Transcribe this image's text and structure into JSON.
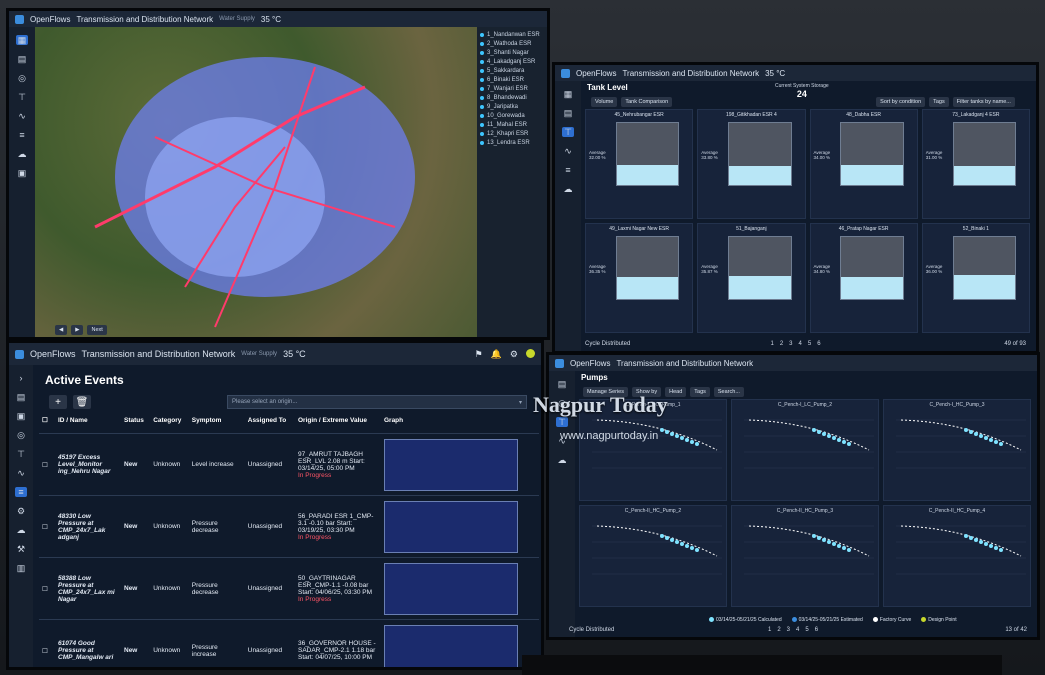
{
  "brand": {
    "app_name": "OpenFlows",
    "accent": "#2e6fd1"
  },
  "panels": {
    "map": {
      "title": "Transmission and Distribution Network",
      "subtitle": "Water Supply",
      "temp": "35 °C",
      "layers": [
        "1_Nandanwan ESR",
        "2_Wathoda ESR",
        "3_Shanti Nagar",
        "4_Lakadganj ESR",
        "5_Sakkardara",
        "6_Binaki ESR",
        "7_Wanjari ESR",
        "8_Bhandewadi",
        "9_Jaripatka",
        "10_Gorewada",
        "11_Mahal ESR",
        "12_Khapri ESR",
        "13_Lendra ESR"
      ],
      "footer_btn": "Next"
    },
    "tanks": {
      "title": "Tank Level",
      "app": "OpenFlows",
      "header": "Transmission and Distribution Network",
      "temp": "35 °C",
      "current_storage_label": "Current System Storage",
      "current_storage_value": "24",
      "toolbar": [
        "Volume",
        "Tank Comparison",
        "Sort by condition",
        "Tags",
        "Filter tanks by name..."
      ],
      "cards": [
        {
          "name": "45_Nehrubangar ESR",
          "fill": 0.32,
          "avg": "Average 32.00 %"
        },
        {
          "name": "198_Gitikhadan ESR 4",
          "fill": 0.3,
          "avg": "Average 33.80 %"
        },
        {
          "name": "48_Dabha ESR",
          "fill": 0.33,
          "avg": "Average 34.00 %"
        },
        {
          "name": "73_Lakadganj 4 ESR",
          "fill": 0.31,
          "avg": "Average 31.00 %"
        },
        {
          "name": "49_Laxmi Nagar New ESR",
          "fill": 0.36,
          "avg": "Average 36.35 %"
        },
        {
          "name": "51_Bajanganj",
          "fill": 0.37,
          "avg": "Average 35.87 %"
        },
        {
          "name": "46_Pratap Nagar ESR",
          "fill": 0.35,
          "avg": "Average 34.80 %"
        },
        {
          "name": "52_Binaki 1",
          "fill": 0.38,
          "avg": "Average 36.00 %"
        }
      ],
      "footer_left": "Cycle Distributed",
      "pages": [
        "1",
        "2",
        "3",
        "4",
        "5",
        "6"
      ],
      "page_info": "49 of 93"
    },
    "events": {
      "app": "OpenFlows",
      "header": "Transmission and Distribution Network",
      "subheader": "Water Supply",
      "temp": "35 °C",
      "title": "Active Events",
      "add_label": "+",
      "delete_label": "🗑",
      "origin_placeholder": "Please select an origin...",
      "columns": [
        "ID / Name",
        "Status",
        "Category",
        "Symptom",
        "Assigned To",
        "Origin / Extreme Value",
        "Graph"
      ],
      "rows": [
        {
          "id_name": "45197 Excess Level_Monitor ing_Nehru Nagar",
          "status": "New",
          "category": "Unknown",
          "symptom": "Level increase",
          "assigned": "Unassigned",
          "origin": "97_AMRUT TAJBAGH ESR_LVL 2.08 m Start: 03/14/25, 05:00 PM",
          "progress": "In Progress"
        },
        {
          "id_name": "48330 Low Pressure at CMP_24x7_Lak adganj",
          "status": "New",
          "category": "Unknown",
          "symptom": "Pressure decrease",
          "assigned": "Unassigned",
          "origin": "56_PARADI ESR 1_CMP-3.1 -0.10 bar Start: 03/19/25, 03:30 PM",
          "progress": "In Progress"
        },
        {
          "id_name": "58388 Low Pressure at CMP_24x7_Lax mi Nagar",
          "status": "New",
          "category": "Unknown",
          "symptom": "Pressure decrease",
          "assigned": "Unassigned",
          "origin": "50_GAYTRINAGAR ESR_CMP-1.1 -0.08 bar Start: 04/06/25, 03:30 PM",
          "progress": "In Progress"
        },
        {
          "id_name": "61074 Good Pressure at CMP_Mangalw ari",
          "status": "New",
          "category": "Unknown",
          "symptom": "Pressure increase",
          "assigned": "Unassigned",
          "origin": "36_GOVERNOR HOUSE - SADAR_CMP-2.1 1.18 bar Start: 04/07/25, 10:00 PM",
          "progress": ""
        }
      ]
    },
    "pumps": {
      "app": "OpenFlows",
      "header": "Transmission and Distribution Network",
      "title": "Pumps",
      "toolbar": [
        "Manage Series",
        "Show by",
        "Head",
        "Tags",
        "Search..."
      ],
      "cards": [
        "C_Pench-I_HC_Pump_1",
        "C_Pench-I_LC_Pump_2",
        "C_Pench-I_HC_Pump_3",
        "C_Pench-II_HC_Pump_2",
        "C_Pench-II_HC_Pump_3",
        "C_Pench-II_HC_Pump_4"
      ],
      "legend": [
        "03/14/25-05/21/25 Calculated",
        "03/14/25-05/21/25 Estimated",
        "Factory Curve",
        "Design Point"
      ],
      "footer_left": "Cycle Distributed",
      "pages": [
        "1",
        "2",
        "3",
        "4",
        "5",
        "6"
      ],
      "page_info": "13 of 42"
    }
  },
  "watermark": {
    "name": "Nagpur Today",
    "url": "www.nagpurtoday.in"
  }
}
